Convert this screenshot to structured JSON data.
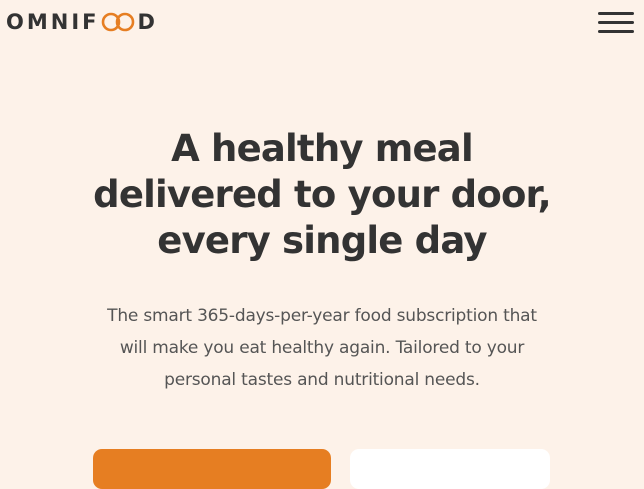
{
  "brand": {
    "logo_left": "OMNIF",
    "logo_right": "D",
    "accent_color": "#e67e22"
  },
  "nav": {
    "menu_icon": "hamburger-menu-icon"
  },
  "hero": {
    "title_line1": "A healthy meal",
    "title_line2": "delivered to your door,",
    "title_line3": "every single day",
    "description_line1": "The smart 365-days-per-year food subscription that",
    "description_line2": "will make you eat healthy again. Tailored to your",
    "description_line3": "personal tastes and nutritional needs."
  },
  "colors": {
    "background": "#fdf2e9",
    "text": "#333333",
    "primary_button": "#e67e22",
    "secondary_button": "#ffffff"
  }
}
